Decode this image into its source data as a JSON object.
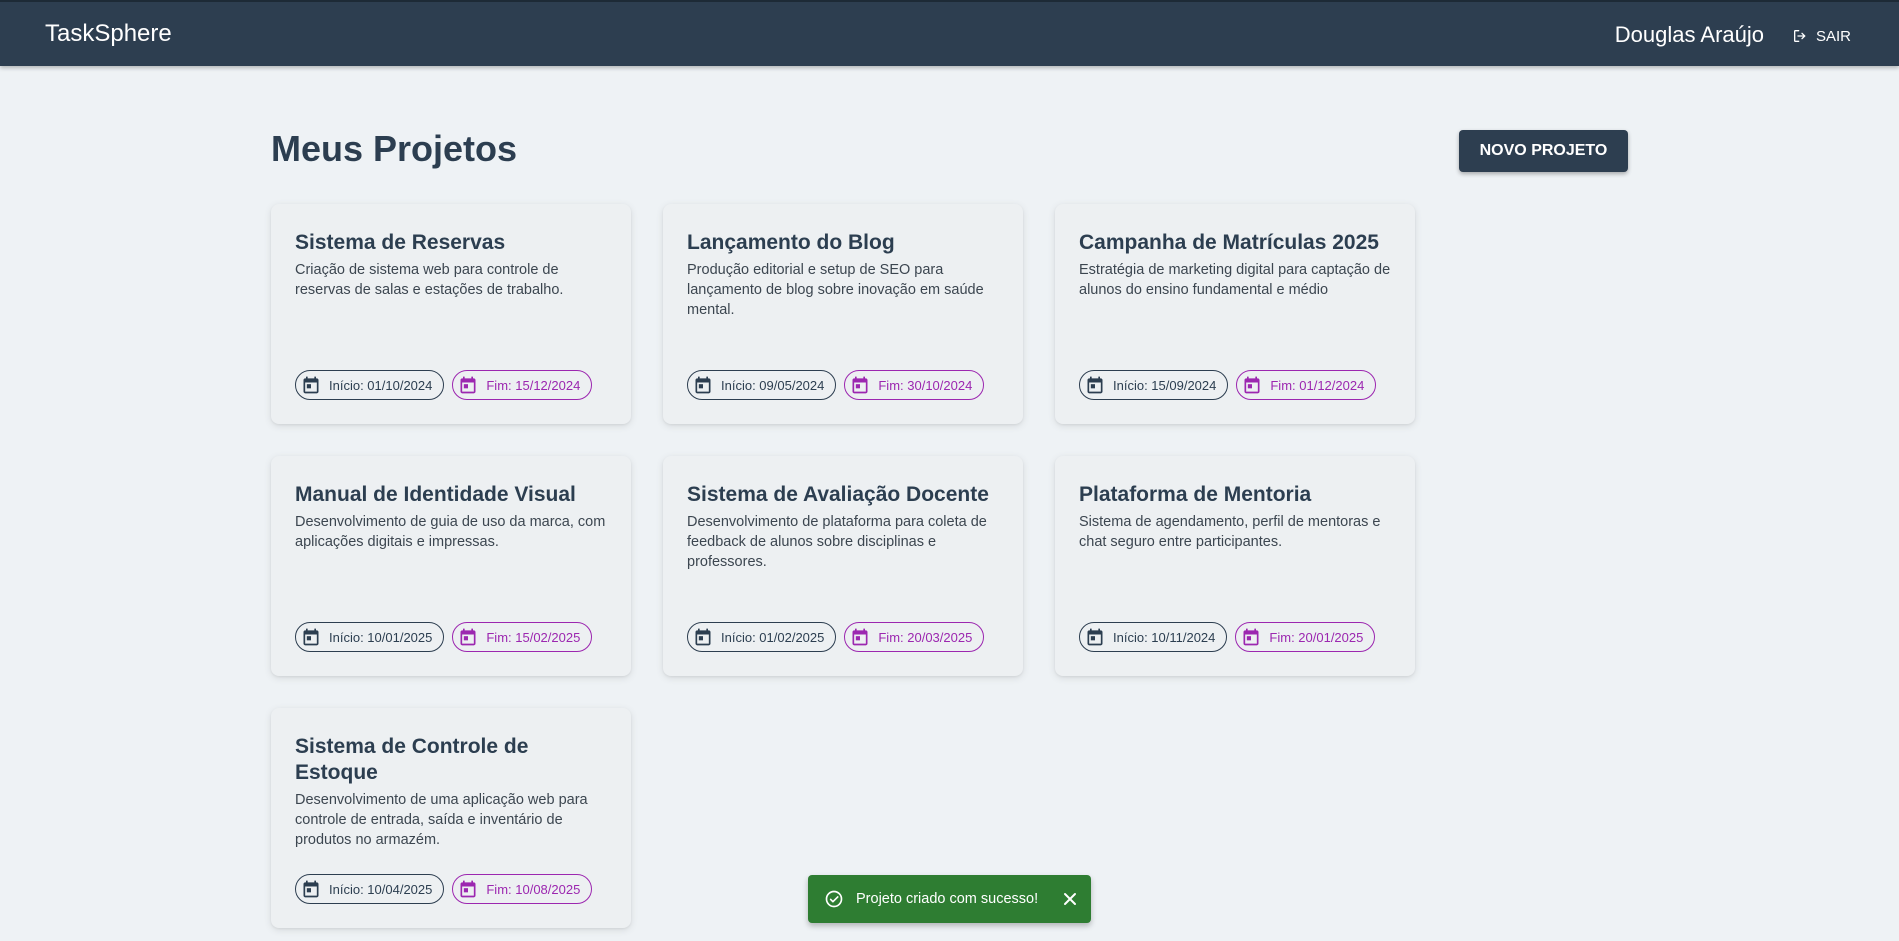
{
  "header": {
    "brand": "TaskSphere",
    "user_name": "Douglas Araújo",
    "logout_label": "SAIR",
    "logout_icon": "logout-icon"
  },
  "main": {
    "title": "Meus Projetos",
    "new_project_label": "NOVO PROJETO"
  },
  "projects": [
    {
      "title": "Sistema de Reservas",
      "description": "Criação de sistema web para controle de reservas de salas e estações de trabalho.",
      "start": "Início: 01/10/2024",
      "end": "Fim: 15/12/2024"
    },
    {
      "title": "Lançamento do Blog",
      "description": "Produção editorial e setup de SEO para lançamento de blog sobre inovação em saúde mental.",
      "start": "Início: 09/05/2024",
      "end": "Fim: 30/10/2024"
    },
    {
      "title": "Campanha de Matrículas 2025",
      "description": "Estratégia de marketing digital para captação de alunos do ensino fundamental e médio",
      "start": "Início: 15/09/2024",
      "end": "Fim: 01/12/2024"
    },
    {
      "title": "Manual de Identidade Visual",
      "description": "Desenvolvimento de guia de uso da marca, com aplicações digitais e impressas.",
      "start": "Início: 10/01/2025",
      "end": "Fim: 15/02/2025"
    },
    {
      "title": "Sistema de Avaliação Docente",
      "description": "Desenvolvimento de plataforma para coleta de feedback de alunos sobre disciplinas e professores.",
      "start": "Início: 01/02/2025",
      "end": "Fim: 20/03/2025"
    },
    {
      "title": "Plataforma de Mentoria",
      "description": "Sistema de agendamento, perfil de mentoras e chat seguro entre participantes.",
      "start": "Início: 10/11/2024",
      "end": "Fim: 20/01/2025"
    },
    {
      "title": "Sistema de Controle de Estoque",
      "description": "Desenvolvimento de uma aplicação web para controle de entrada, saída e inventário de produtos no armazém.",
      "start": "Início: 10/04/2025",
      "end": "Fim: 10/08/2025"
    }
  ],
  "snackbar": {
    "message": "Projeto criado com sucesso!",
    "icon": "check-circle-icon",
    "close_icon": "close-icon"
  },
  "colors": {
    "appbar": "#2d3e50",
    "background": "#eef2f5",
    "card": "#edf0f2",
    "primary": "#2d3e50",
    "secondary": "#9c27b0",
    "success": "#2e7d32"
  }
}
